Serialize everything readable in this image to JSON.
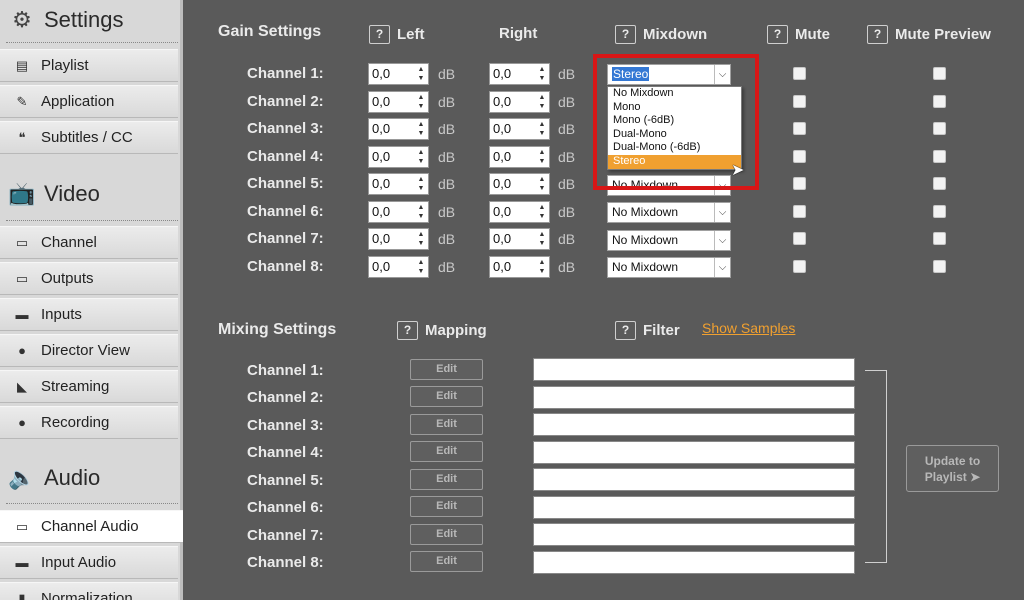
{
  "sidebar": {
    "sections": [
      {
        "title": "Settings",
        "icon": "gear-icon",
        "items": [
          {
            "label": "Playlist",
            "icon": "playlist-icon"
          },
          {
            "label": "Application",
            "icon": "wrench-icon"
          },
          {
            "label": "Subtitles / CC",
            "icon": "chat-bubbles-icon"
          }
        ]
      },
      {
        "title": "Video",
        "icon": "tv-icon",
        "items": [
          {
            "label": "Channel",
            "icon": "tv-icon"
          },
          {
            "label": "Outputs",
            "icon": "monitor-icon"
          },
          {
            "label": "Inputs",
            "icon": "camera-icon"
          },
          {
            "label": "Director View",
            "icon": "person-icon"
          },
          {
            "label": "Streaming",
            "icon": "rss-icon"
          },
          {
            "label": "Recording",
            "icon": "record-dot-icon"
          }
        ]
      },
      {
        "title": "Audio",
        "icon": "speaker-icon",
        "items": [
          {
            "label": "Channel Audio",
            "icon": "tv-icon",
            "active": true
          },
          {
            "label": "Input Audio",
            "icon": "camera-icon"
          },
          {
            "label": "Normalization",
            "icon": "bars-icon"
          }
        ]
      }
    ]
  },
  "gain": {
    "title": "Gain Settings",
    "col_left": "Left",
    "col_right": "Right",
    "col_mixdown": "Mixdown",
    "col_mute": "Mute",
    "col_mute_preview": "Mute Preview",
    "help": "?",
    "unit": "dB",
    "channels": [
      {
        "label": "Channel 1:",
        "left": "0,0",
        "right": "0,0",
        "mixdown": "Stereo"
      },
      {
        "label": "Channel 2:",
        "left": "0,0",
        "right": "0,0",
        "mixdown": ""
      },
      {
        "label": "Channel 3:",
        "left": "0,0",
        "right": "0,0",
        "mixdown": ""
      },
      {
        "label": "Channel 4:",
        "left": "0,0",
        "right": "0,0",
        "mixdown": ""
      },
      {
        "label": "Channel 5:",
        "left": "0,0",
        "right": "0,0",
        "mixdown": "No Mixdown"
      },
      {
        "label": "Channel 6:",
        "left": "0,0",
        "right": "0,0",
        "mixdown": "No Mixdown"
      },
      {
        "label": "Channel 7:",
        "left": "0,0",
        "right": "0,0",
        "mixdown": "No Mixdown"
      },
      {
        "label": "Channel 8:",
        "left": "0,0",
        "right": "0,0",
        "mixdown": "No Mixdown"
      }
    ],
    "mixdown_options": [
      "No Mixdown",
      "Mono",
      "Mono (-6dB)",
      "Dual-Mono",
      "Dual-Mono (-6dB)",
      "Stereo"
    ],
    "mixdown_highlighted": "Stereo"
  },
  "mixing": {
    "title": "Mixing Settings",
    "col_mapping": "Mapping",
    "col_filter": "Filter",
    "show_samples": "Show Samples",
    "edit_label": "Edit",
    "channels": [
      "Channel 1:",
      "Channel 2:",
      "Channel 3:",
      "Channel 4:",
      "Channel 5:",
      "Channel 6:",
      "Channel 7:",
      "Channel 8:"
    ],
    "update_line1": "Update to",
    "update_line2": "Playlist ➤"
  },
  "colors": {
    "accent": "#f0a030",
    "highlight_box": "#d81616",
    "background": "#5a5a5a"
  }
}
